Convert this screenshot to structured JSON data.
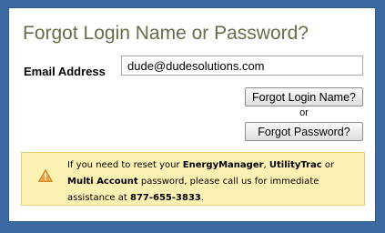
{
  "dialog": {
    "title": "Forgot Login Name or Password?"
  },
  "form": {
    "email_label": "Email Address",
    "email_value": "dude@dudesolutions.com"
  },
  "buttons": {
    "forgot_login_label": "Forgot Login Name?",
    "or_label": "or",
    "forgot_password_label": "Forgot Password?"
  },
  "notice": {
    "icon": "warning-icon",
    "text_1": "If you need to reset your ",
    "product_1": "EnergyManager",
    "sep_1": ", ",
    "product_2": "UtilityTrac",
    "text_2": " or ",
    "product_3": "Multi Account",
    "text_3": " password, please call us for immediate assistance at ",
    "phone": "877-655-3833",
    "text_4": "."
  },
  "colors": {
    "page_background": "#3b6aa3",
    "title_color": "#6b6b4a",
    "notice_background": "#fbf1b3",
    "notice_border": "#e3d17a",
    "warning_icon_fill": "#e8a33c"
  }
}
